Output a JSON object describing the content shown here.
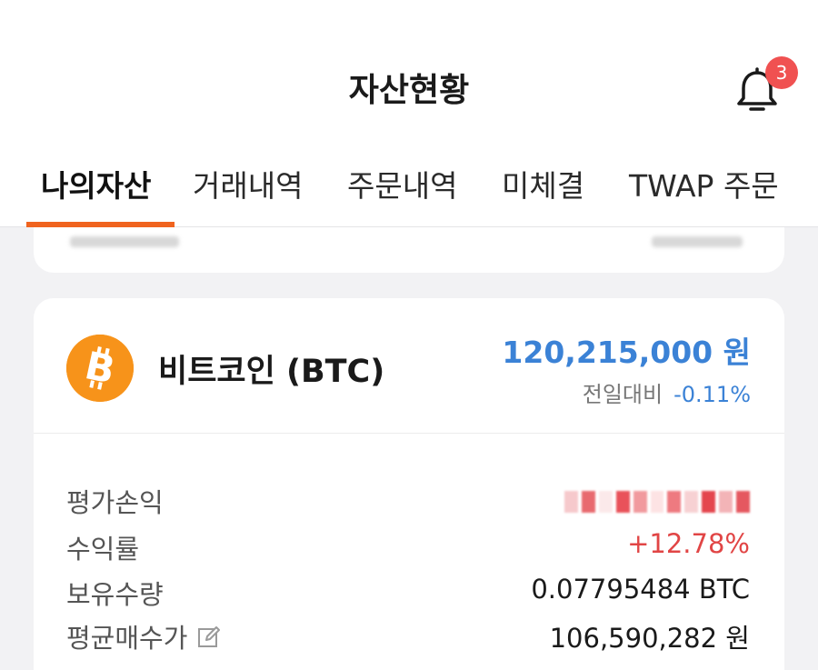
{
  "header": {
    "title": "자산현황",
    "notification_count": "3"
  },
  "tabs": [
    {
      "label": "나의자산",
      "active": true
    },
    {
      "label": "거래내역",
      "active": false
    },
    {
      "label": "주문내역",
      "active": false
    },
    {
      "label": "미체결",
      "active": false
    },
    {
      "label": "TWAP 주문",
      "active": false
    }
  ],
  "coin": {
    "name": "비트코인 (BTC)",
    "icon": "bitcoin-icon",
    "price": "120,215,000 원",
    "change_label": "전일대비",
    "change_value": "-0.11%"
  },
  "details": {
    "profit_loss_label": "평가손익",
    "return_rate_label": "수익률",
    "return_rate_value": "+12.78%",
    "holdings_label": "보유수량",
    "holdings_value": "0.07795484 BTC",
    "avg_price_label": "평균매수가",
    "avg_price_value": "106,590,282 원"
  },
  "colors": {
    "accent": "#f0631e",
    "price_blue": "#3b82d6",
    "profit_red": "#e14545",
    "badge_red": "#f05151",
    "bitcoin_orange": "#f7931a"
  }
}
